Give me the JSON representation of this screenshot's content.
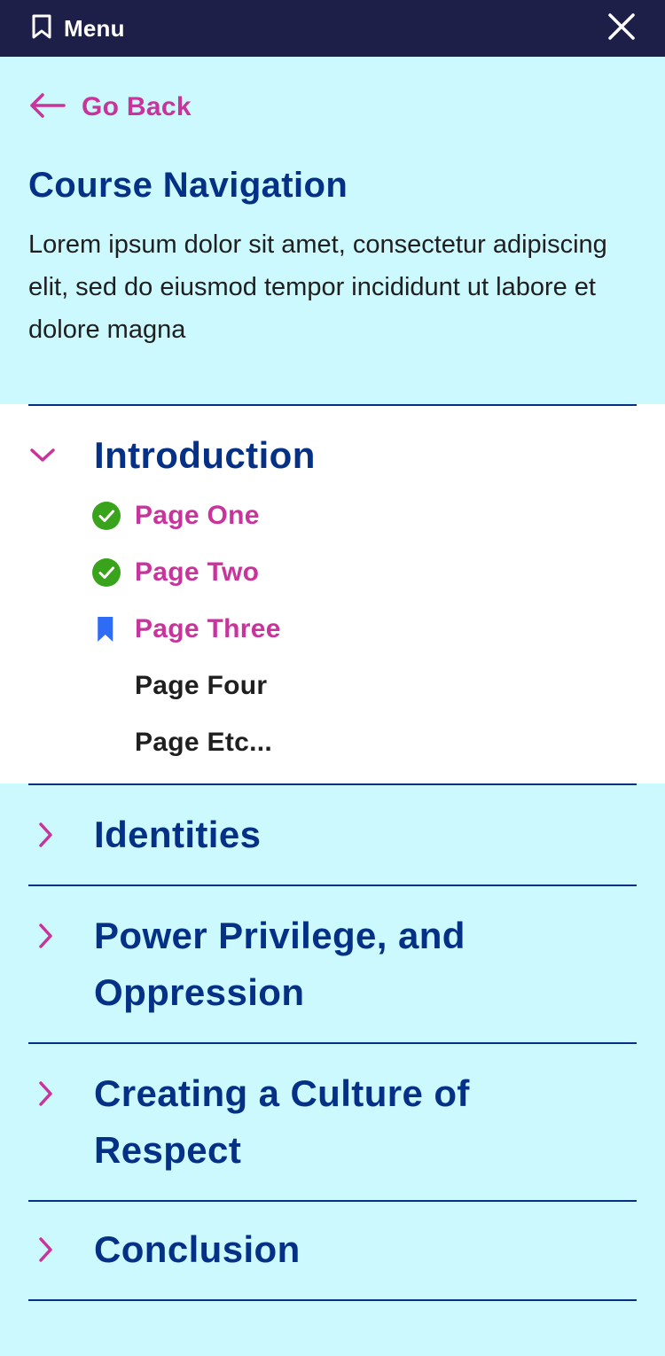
{
  "topbar": {
    "menu_label": "Menu",
    "menu_icon": "bookmark-outline-icon",
    "close_icon": "close-icon",
    "bg_color": "#1e1f48"
  },
  "back": {
    "label": "Go Back",
    "icon": "arrow-left-icon"
  },
  "title": "Course Navigation",
  "description": "Lorem ipsum dolor sit amet, consectetur adipiscing elit, sed do eiusmod tempor incididunt ut labore et dolore magna",
  "colors": {
    "accent": "#c8349c",
    "heading": "#043086",
    "complete": "#3aa31c",
    "current": "#2e6cf6",
    "panel_bg": "#cbf9fe"
  },
  "sections": [
    {
      "title": "Introduction",
      "expanded": true,
      "pages": [
        {
          "label": "Page One",
          "status": "complete",
          "icon": "check-circle-icon"
        },
        {
          "label": "Page Two",
          "status": "complete",
          "icon": "check-circle-icon"
        },
        {
          "label": "Page Three",
          "status": "current",
          "icon": "bookmark-icon"
        },
        {
          "label": "Page Four",
          "status": "unvisited"
        },
        {
          "label": "Page Etc...",
          "status": "unvisited"
        }
      ]
    },
    {
      "title": "Identities",
      "expanded": false
    },
    {
      "title": "Power Privilege, and Oppression",
      "expanded": false
    },
    {
      "title": "Creating a Culture of Respect",
      "expanded": false
    },
    {
      "title": "Conclusion",
      "expanded": false
    }
  ]
}
